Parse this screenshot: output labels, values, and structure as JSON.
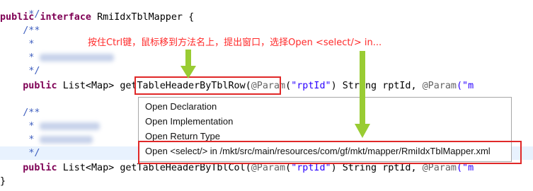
{
  "code": {
    "comment_end_top": " */",
    "kw_public": "public",
    "kw_interface": "interface",
    "interface_name": "RmiIdxTblMapper",
    "open_brace": "{",
    "javadoc_open": "/**",
    "javadoc_star": "*",
    "javadoc_close": "*/",
    "return_type": "List<Map>",
    "method_1": "getTableHeaderByTblRow",
    "method_2": "getTableHeaderByTblCol",
    "open_paren": "(",
    "param_annotation": "@Param",
    "param_open": "(",
    "param_string": "\"rptId\"",
    "param_close": ")",
    "param_type": "String",
    "param_name": "rptId,",
    "param_annotation_2": "@Param",
    "param_string_2_partial": "(\"m",
    "close_brace": "}"
  },
  "annotation_text": "按住Ctrl键，鼠标移到方法名上，提出窗口，选择Open <select/> in...",
  "popup": {
    "items": [
      {
        "label": "Open Declaration"
      },
      {
        "label": "Open Implementation"
      },
      {
        "label": "Open Return Type"
      },
      {
        "label": "Open <select/> in /mkt/src/main/resources/com/gf/mkt/mapper/RmiIdxTblMapper.xml"
      }
    ]
  },
  "colors": {
    "keyword": "#7f0055",
    "comment": "#3f5fbf",
    "string": "#2a00ff",
    "annotation": "#646464",
    "highlight_box": "#e02828",
    "arrow": "#99cc33",
    "line_highlight": "#e8f2fe"
  }
}
